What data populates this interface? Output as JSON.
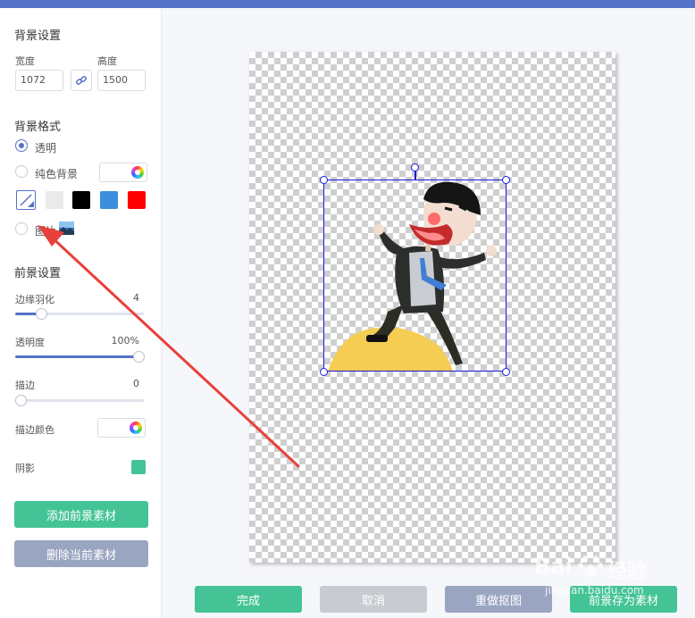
{
  "bg_settings": {
    "title": "背景设置",
    "width_label": "宽度",
    "height_label": "高度",
    "width_value": "1072",
    "height_value": "1500"
  },
  "bg_format": {
    "title": "背景格式",
    "transparent_label": "透明",
    "solid_label": "纯色背景",
    "image_label": "图片",
    "selected": "透明",
    "swatches": [
      "#eaeaea",
      "#000000",
      "#3b8fdc",
      "#ff0000"
    ]
  },
  "fg_settings": {
    "title": "前景设置",
    "feather_label": "边缘羽化",
    "feather_value": "4",
    "opacity_label": "透明度",
    "opacity_value": "100%",
    "stroke_label": "描边",
    "stroke_value": "0",
    "stroke_color_label": "描边颜色",
    "shadow_label": "阴影",
    "shadow_color": "#44c496"
  },
  "sliders": {
    "feather_fraction": 0.2,
    "opacity_fraction": 1.0,
    "stroke_fraction": 0.0
  },
  "buttons": {
    "add_fg": "添加前景素材",
    "delete_fg": "删除当前素材",
    "done": "完成",
    "cancel": "取消",
    "redo": "重做抠图",
    "save_fg": "前景存为素材"
  },
  "colors": {
    "accent": "#5472c8",
    "green": "#44c496",
    "gray_button": "#9aa5c2",
    "light_gray_button": "#c8cbd1",
    "selection": "#1a1adb",
    "arrow": "#e8403a"
  },
  "watermark": {
    "brand": "Bai",
    "brand2": "经验",
    "url": "jingyan.baidu.com"
  }
}
